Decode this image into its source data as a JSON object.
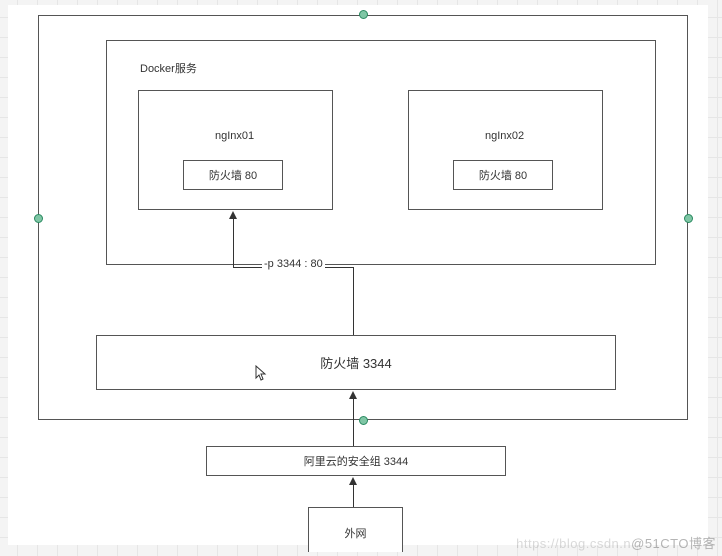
{
  "outer": {
    "docker_label": "Docker服务",
    "nginx01_label": "ngInx01",
    "nginx01_fw": "防火墙  80",
    "nginx02_label": "ngInx02",
    "nginx02_fw": "防火墙  80",
    "port_map_label": "-p 3344 : 80",
    "firewall_main": "防火墙   3344",
    "sec_group": "阿里云的安全组   3344",
    "external": "外网"
  },
  "watermark": {
    "faint": "https://blog.csdn.n",
    "main": "@51CTO博客"
  }
}
